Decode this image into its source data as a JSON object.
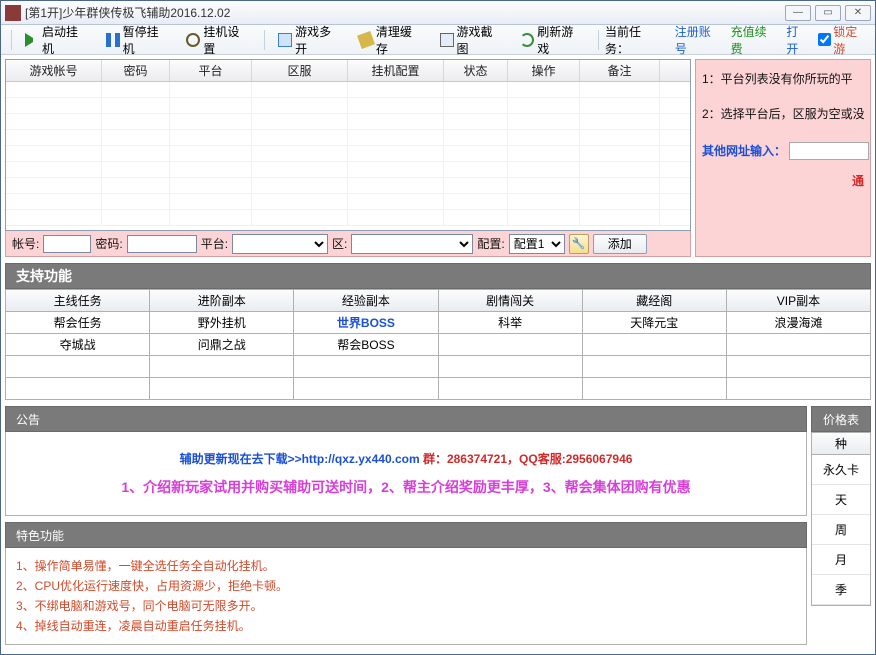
{
  "window": {
    "title": "[第1开]少年群侠传极飞辅助2016.12.02"
  },
  "toolbar": {
    "start": "启动挂机",
    "pause": "暂停挂机",
    "settings": "挂机设置",
    "multi": "游戏多开",
    "clear": "清理缓存",
    "screenshot": "游戏截图",
    "refresh": "刷新游戏",
    "task_label": "当前任务：",
    "register": "注册账号",
    "recharge": "充值续费",
    "open": "打开",
    "lock": "锁定游"
  },
  "table": {
    "cols": [
      "游戏帐号",
      "密码",
      "平台",
      "区服",
      "挂机配置",
      "状态",
      "操作",
      "备注"
    ],
    "widths": [
      96,
      68,
      82,
      96,
      96,
      64,
      72,
      80
    ]
  },
  "hints": {
    "h1": "1：平台列表没有你所玩的平",
    "h2": "2：选择平台后，区服为空或没",
    "url_label": "其他网址输入：",
    "pass": "通"
  },
  "inputbar": {
    "acct": "帐号:",
    "pwd": "密码:",
    "plat": "平台:",
    "zone": "区:",
    "cfg": "配置:",
    "cfg_val": "配置1",
    "add": "添加"
  },
  "support": {
    "title": "支持功能",
    "rows": [
      [
        "主线任务",
        "进阶副本",
        "经验副本",
        "剧情闯关",
        "藏经阁",
        "VIP副本"
      ],
      [
        "帮会任务",
        "野外挂机",
        "世界BOSS",
        "科举",
        "天降元宝",
        "浪漫海滩"
      ],
      [
        "夺城战",
        "问鼎之战",
        "帮会BOSS",
        "",
        "",
        ""
      ],
      [
        "",
        "",
        "",
        "",
        "",
        ""
      ],
      [
        "",
        "",
        "",
        "",
        "",
        ""
      ]
    ]
  },
  "notice": {
    "title": "公告",
    "l1a": "辅助更新现在去下载>>",
    "l1b": "http://qxz.yx440.com",
    "l1c": " 群：286374721，QQ客服:2956067946",
    "l2": "1、介绍新玩家试用并购买辅助可送时间，2、帮主介绍奖励更丰厚，3、帮会集体团购有优惠"
  },
  "feat": {
    "title": "特色功能",
    "lines": [
      "1、操作简单易懂，一键全选任务全自动化挂机。",
      "2、CPU优化运行速度快，占用资源少，拒绝卡顿。",
      "3、不绑电脑和游戏号，同个电脑可无限多开。",
      "4、掉线自动重连，凌晨自动重启任务挂机。"
    ]
  },
  "price": {
    "title": "价格表",
    "hdr": "种",
    "rows": [
      "永久卡",
      "天",
      "周",
      "月",
      "季"
    ]
  }
}
